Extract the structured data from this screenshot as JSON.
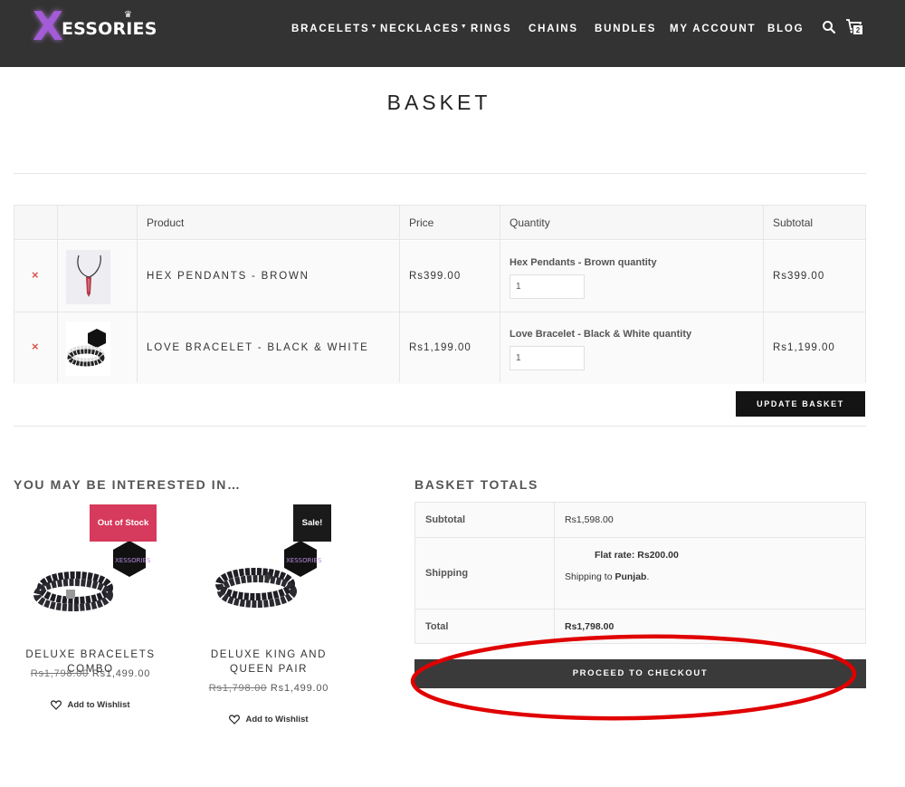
{
  "header": {
    "logo": {
      "x": "X",
      "rest": "ESSORIES"
    },
    "nav": [
      {
        "label": "BRACELETS",
        "caret": true
      },
      {
        "label": "NECKLACES",
        "caret": true
      },
      {
        "label": "RINGS",
        "caret": false
      },
      {
        "label": "CHAINS",
        "caret": false
      },
      {
        "label": "BUNDLES",
        "caret": false
      },
      {
        "label": "MY ACCOUNT",
        "caret": false
      },
      {
        "label": "BLOG",
        "caret": false
      }
    ],
    "cart_count": "2",
    "icons": {
      "search": "search-icon",
      "cart": "cart-icon"
    }
  },
  "page": {
    "title": "BASKET"
  },
  "cart": {
    "headers": {
      "product": "Product",
      "price": "Price",
      "quantity": "Quantity",
      "subtotal": "Subtotal"
    },
    "items": [
      {
        "name": "HEX PENDANTS - BROWN",
        "price": "Rs399.00",
        "qty_label": "Hex Pendants - Brown quantity",
        "qty": "1",
        "subtotal": "Rs399.00"
      },
      {
        "name": "LOVE BRACELET - BLACK & WHITE",
        "price": "Rs1,199.00",
        "qty_label": "Love Bracelet - Black & White quantity",
        "qty": "1",
        "subtotal": "Rs1,199.00"
      }
    ],
    "remove_symbol": "×",
    "update_label": "UPDATE BASKET"
  },
  "cross_sells": {
    "title": "YOU MAY BE INTERESTED IN…",
    "products": [
      {
        "badge": "Out of Stock",
        "name": "DELUXE BRACELETS COMBO",
        "old_price": "Rs1,798.00",
        "price": "Rs1,499.00",
        "wishlist": "Add to Wishlist"
      },
      {
        "badge": "Sale!",
        "name": "DELUXE KING AND QUEEN PAIR",
        "old_price": "Rs1,798.00",
        "price": "Rs1,499.00",
        "wishlist": "Add to Wishlist"
      }
    ]
  },
  "totals": {
    "title": "BASKET TOTALS",
    "subtotal_label": "Subtotal",
    "subtotal": "Rs1,598.00",
    "shipping_label": "Shipping",
    "flat_rate_label": "Flat rate:",
    "flat_rate": "Rs200.00",
    "shipping_to": "Shipping to",
    "region": "Punjab",
    "total_label": "Total",
    "total": "Rs1,798.00",
    "checkout_label": "PROCEED TO CHECKOUT"
  },
  "colors": {
    "header_bg": "#333333",
    "accent_purple": "#a35bd8",
    "out_of_stock": "#d63a5c",
    "annotation_red": "#e00000"
  }
}
